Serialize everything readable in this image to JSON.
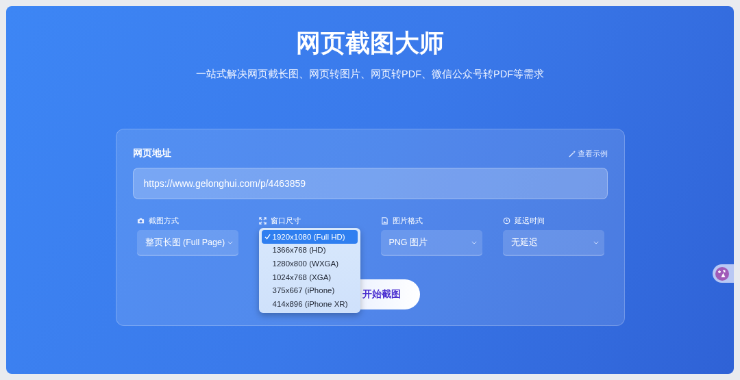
{
  "header": {
    "title": "网页截图大师",
    "subtitle": "一站式解决网页截长图、网页转图片、网页转PDF、微信公众号转PDF等需求"
  },
  "url": {
    "label": "网页地址",
    "example_link": "查看示例",
    "value": "https://www.gelonghui.com/p/4463859"
  },
  "options": [
    {
      "label": "截图方式",
      "value": "整页长图 (Full Page)",
      "open": false
    },
    {
      "label": "窗口尺寸",
      "open": true,
      "choices": [
        {
          "label": "1920x1080 (Full HD)",
          "selected": true
        },
        {
          "label": "1366x768 (HD)",
          "selected": false
        },
        {
          "label": "1280x800 (WXGA)",
          "selected": false
        },
        {
          "label": "1024x768 (XGA)",
          "selected": false
        },
        {
          "label": "375x667 (iPhone)",
          "selected": false
        },
        {
          "label": "414x896 (iPhone XR)",
          "selected": false
        }
      ]
    },
    {
      "label": "图片格式",
      "value": "PNG 图片",
      "open": false
    },
    {
      "label": "延迟时间",
      "value": "无延迟",
      "open": false
    }
  ],
  "start_button": "开始截图"
}
